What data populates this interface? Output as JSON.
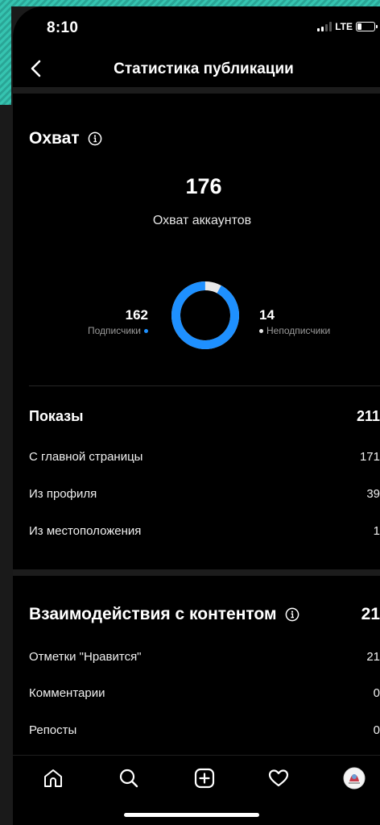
{
  "status": {
    "time": "8:10",
    "network": "LTE",
    "battery_level": 0.25
  },
  "nav": {
    "title": "Статистика публикации"
  },
  "reach": {
    "title": "Охват",
    "accounts_reached": "176",
    "accounts_reached_label": "Охват аккаунтов",
    "followers_count": "162",
    "followers_label": "Подписчики",
    "non_followers_count": "14",
    "non_followers_label": "Неподписчики",
    "followers_fraction": 0.92,
    "followers_color": "#1e90ff",
    "non_followers_color": "#e8e8e8"
  },
  "impressions": {
    "title": "Показы",
    "total": "211",
    "items": [
      {
        "label": "С главной страницы",
        "value": "171"
      },
      {
        "label": "Из профиля",
        "value": "39"
      },
      {
        "label": "Из местоположения",
        "value": "1"
      }
    ]
  },
  "interactions": {
    "title": "Взаимодействия с контентом",
    "total": "21",
    "items": [
      {
        "label": "Отметки \"Нравится\"",
        "value": "21"
      },
      {
        "label": "Комментарии",
        "value": "0"
      },
      {
        "label": "Репосты",
        "value": "0"
      }
    ]
  },
  "tabs": [
    "home-icon",
    "search-icon",
    "create-icon",
    "activity-icon",
    "profile-avatar"
  ]
}
